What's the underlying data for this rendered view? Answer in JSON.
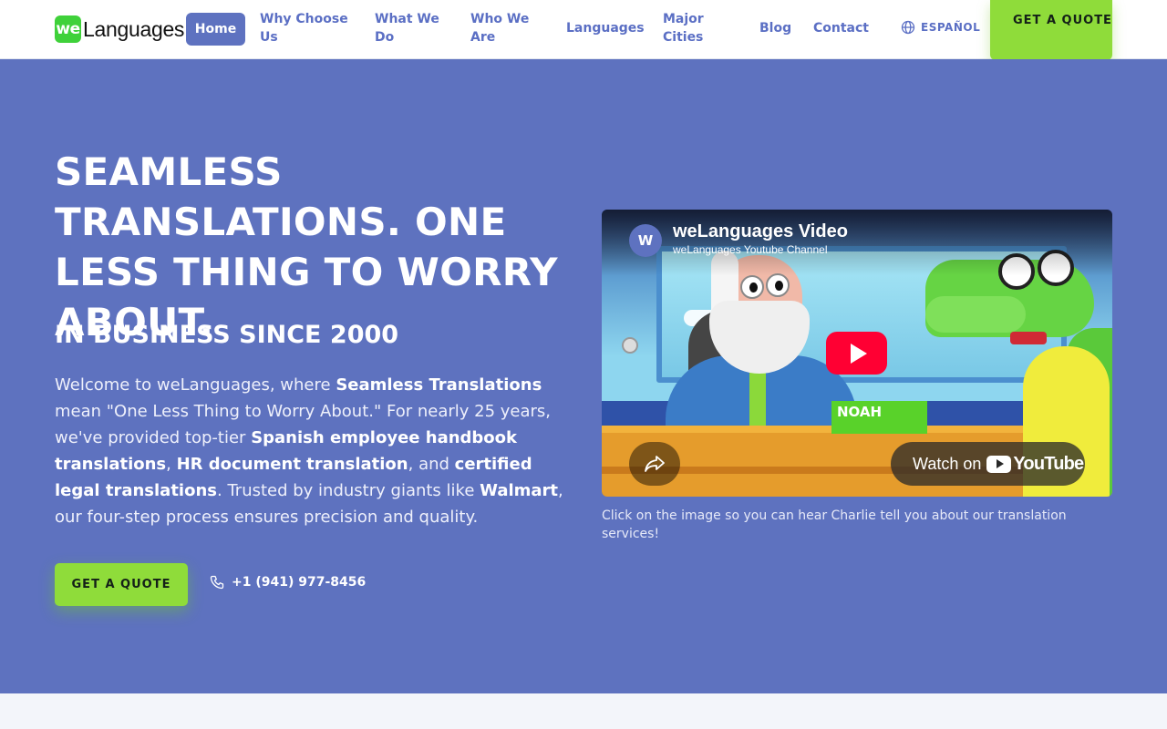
{
  "header": {
    "logo_badge": "we",
    "logo_text": "Languages",
    "nav": [
      {
        "label": "Home"
      },
      {
        "label": "Why Choose Us"
      },
      {
        "label": "What We Do"
      },
      {
        "label": "Who We Are"
      },
      {
        "label": "Languages"
      },
      {
        "label": "Major Cities"
      },
      {
        "label": "Blog"
      },
      {
        "label": "Contact"
      }
    ],
    "language_switch": "ESPAÑOL",
    "quote_button": "GET A QUOTE"
  },
  "hero": {
    "title": "SEAMLESS TRANSLATIONS. ONE LESS THING TO WORRY ABOUT.",
    "subtitle": "IN BUSINESS SINCE 2000",
    "body": {
      "p1": "Welcome to weLanguages, where ",
      "b1": "Seamless Translations",
      "p2": " mean \"One Less Thing to Worry About.\" For nearly 25 years, we've provided top-tier ",
      "b2": "Spanish employee handbook translations",
      "p3": ", ",
      "b3": "HR document translation",
      "p4": ", and ",
      "b4": "certified legal translations",
      "p5": ". Trusted by industry giants like ",
      "b5": "Walmart",
      "p6": ", our four-step process ensures precision and quality."
    },
    "quote_button": "GET A QUOTE",
    "phone": "+1 (941) 977-8456"
  },
  "video": {
    "avatar_letter": "W",
    "title": "weLanguages Video",
    "channel": "weLanguages Youtube Channel",
    "nameplate": "NOAH",
    "watch_label": "Watch on",
    "yt_word": "YouTube",
    "caption": "Click on the image so you can hear Charlie tell you about our translation services!"
  },
  "colors": {
    "brand_blue": "#5e72bf",
    "accent_green": "#8fdc3a",
    "logo_green": "#3fd13a",
    "youtube_red": "#ff0033"
  }
}
